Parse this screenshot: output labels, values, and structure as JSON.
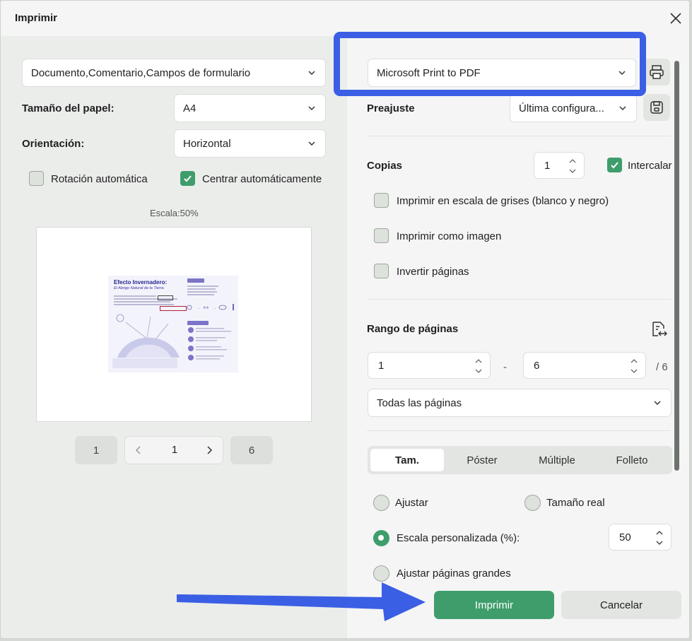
{
  "dialog": {
    "title": "Imprimir"
  },
  "left": {
    "content_select": "Documento,Comentario,Campos de formulario",
    "paper_size_label": "Tamaño del papel:",
    "paper_size_value": "A4",
    "orientation_label": "Orientación:",
    "orientation_value": "Horizontal",
    "auto_rotate_label": "Rotación automática",
    "auto_rotate_checked": false,
    "auto_center_label": "Centrar automáticamente",
    "auto_center_checked": true,
    "scale_label": "Escala:50%",
    "preview_doc": {
      "title": "Efecto Invernadero:",
      "subtitle": "El Abrigo Natural de la Tierra"
    },
    "pager": {
      "first": "1",
      "current": "1",
      "last": "6"
    }
  },
  "right": {
    "printer_select": "Microsoft Print to PDF",
    "preset_label": "Preajuste",
    "preset_value": "Última configura...",
    "copies_label": "Copias",
    "copies_value": "1",
    "collate_label": "Intercalar",
    "collate_checked": true,
    "grayscale_label": "Imprimir en escala de grises (blanco y negro)",
    "as_image_label": "Imprimir como imagen",
    "invert_label": "Invertir páginas",
    "range_label": "Rango de páginas",
    "range_from": "1",
    "range_dash": "-",
    "range_to": "6",
    "range_total": "/ 6",
    "range_select": "Todas las páginas",
    "tabs": [
      "Tam.",
      "Póster",
      "Múltiple",
      "Folleto"
    ],
    "active_tab": "Tam.",
    "fit_label": "Ajustar",
    "actual_size_label": "Tamaño real",
    "custom_scale_label": "Escala personalizada (%):",
    "custom_scale_value": "50",
    "fit_large_label": "Ajustar páginas grandes",
    "selected_scale_option": "Escala personalizada (%):"
  },
  "buttons": {
    "print": "Imprimir",
    "cancel": "Cancelar"
  },
  "colors": {
    "accent_green": "#3f9d6c",
    "highlight_blue": "#3a5fe5"
  }
}
